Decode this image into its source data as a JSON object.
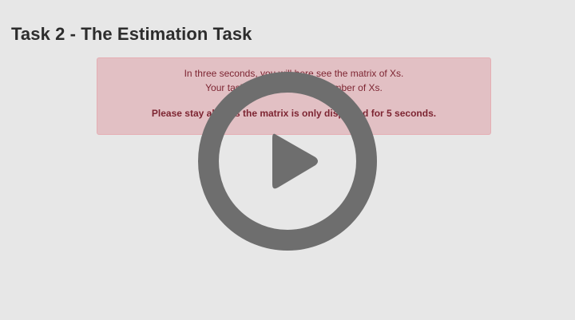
{
  "page": {
    "title": "Task 2 - The Estimation Task"
  },
  "alert": {
    "line1": "In three seconds, you will here see the matrix of Xs.",
    "line2": "Your task is to estimate the number of Xs.",
    "warning": "Please stay alert as the matrix is only displayed for 5 seconds."
  },
  "overlay": {
    "icon": "play-icon",
    "color": "#6e6e6e"
  },
  "colors": {
    "background": "#e7e7e7",
    "alert_background": "#e2c0c4",
    "alert_text": "#7d2532"
  }
}
